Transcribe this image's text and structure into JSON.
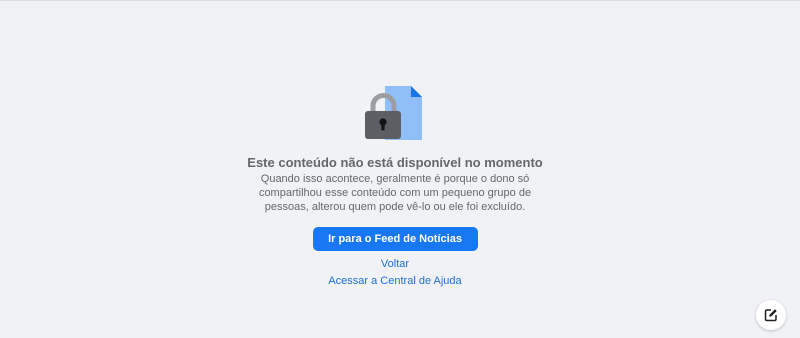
{
  "message": {
    "title": "Este conteúdo não está disponível no momento",
    "description": "Quando isso acontece, geralmente é porque o dono só compartilhou esse conteúdo com um pequeno grupo de pessoas, alterou quem pode vê-lo ou ele foi excluído.",
    "illustration_icon": "lock-document-icon"
  },
  "actions": {
    "primary_label": "Ir para o Feed de Notícias",
    "back_label": "Voltar",
    "help_label": "Acessar a Central de Ajuda"
  },
  "floating": {
    "icon": "new-message-icon"
  },
  "colors": {
    "background": "#f0f2f5",
    "primary": "#1877f2",
    "link": "#216fdb",
    "text_secondary": "#65676b"
  }
}
